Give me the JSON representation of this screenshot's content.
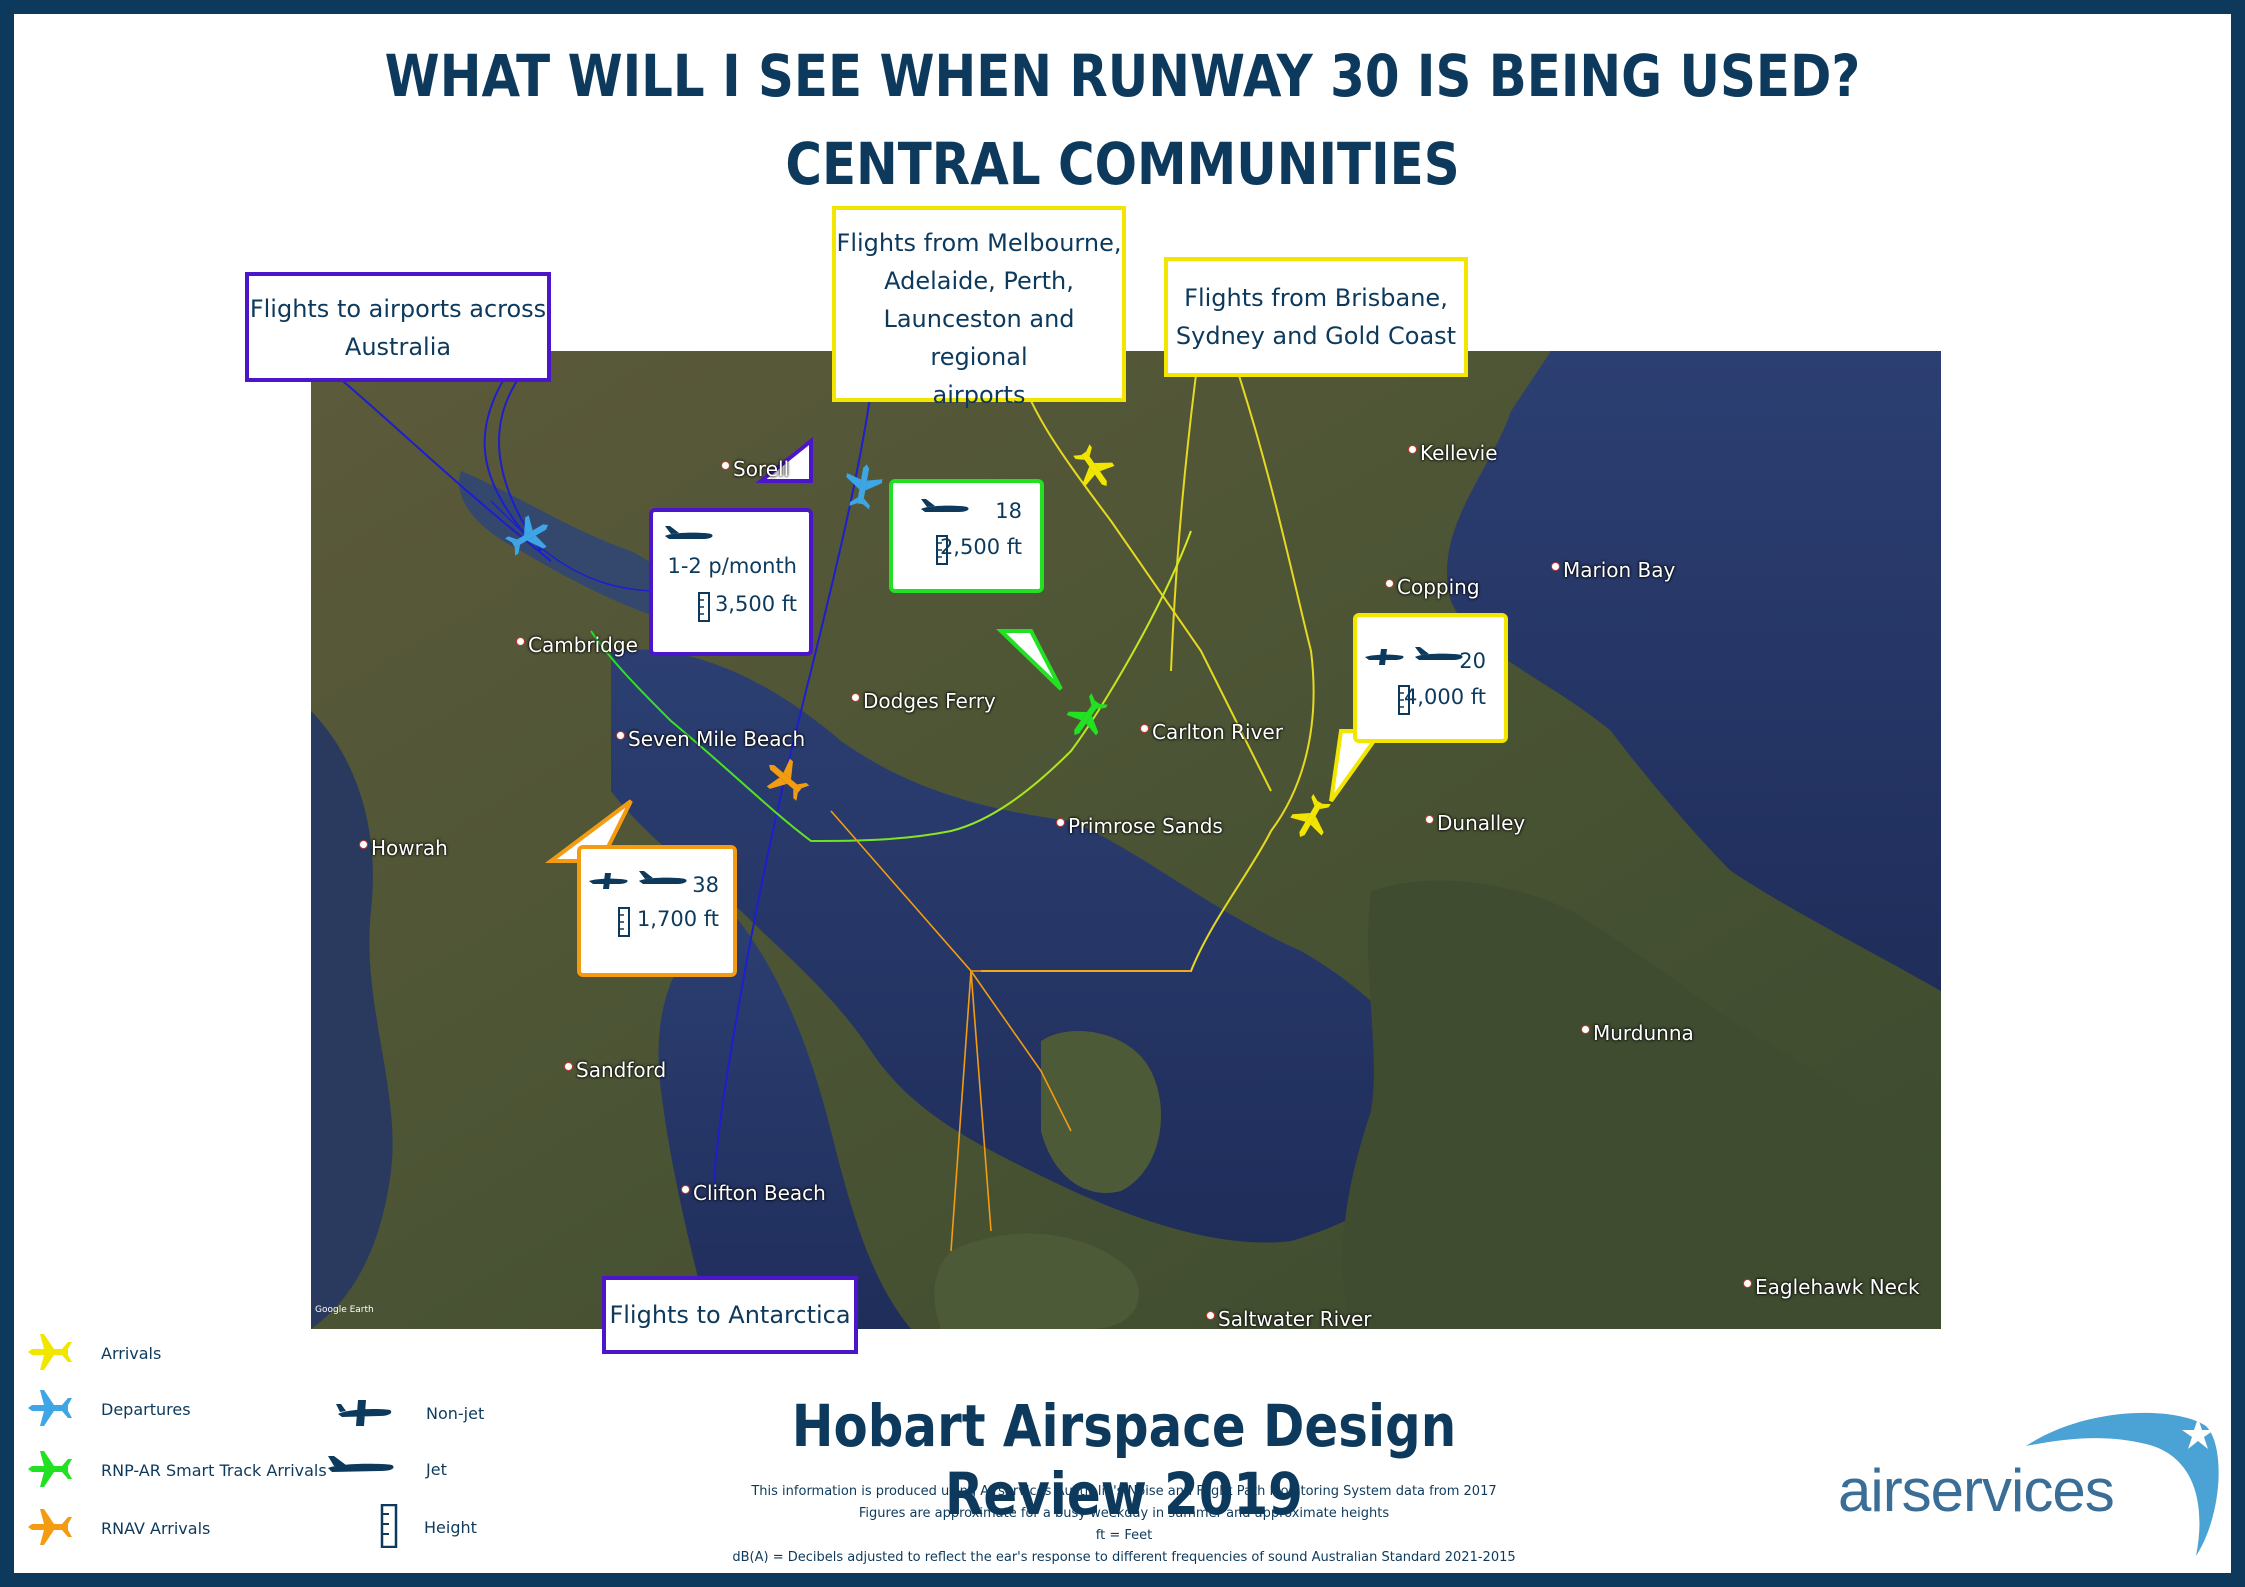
{
  "title_line1": "WHAT WILL I SEE WHEN RUNWAY 30 IS BEING USED?",
  "title_line2": "CENTRAL COMMUNITIES",
  "colors": {
    "frame": "#0d3a5c",
    "arrivals": "#f2e600",
    "departures": "#3ea6e6",
    "rnp_ar": "#22e022",
    "rnav": "#f39c12",
    "departure_box": "#4b16c9"
  },
  "callouts": {
    "departures_australia": [
      "Flights to airports across",
      "Australia"
    ],
    "arrivals_melbourne": [
      "Flights from Melbourne,",
      "Adelaide, Perth,",
      "Launceston and regional",
      "airports"
    ],
    "arrivals_brisbane": [
      "Flights from Brisbane,",
      "Sydney and Gold Coast"
    ],
    "departures_antarctica": [
      "Flights to Antarctica"
    ]
  },
  "stats": {
    "purple": {
      "count": "1-2 p/month",
      "height": "3,500 ft",
      "aircraft_icons": [
        "jet-icon"
      ]
    },
    "green": {
      "count": "18",
      "height": "2,500 ft",
      "aircraft_icons": [
        "jet-icon"
      ]
    },
    "yellow": {
      "count": "20",
      "height": "4,000 ft",
      "aircraft_icons": [
        "non-jet-icon",
        "jet-icon"
      ]
    },
    "orange": {
      "count": "38",
      "height": "1,700 ft",
      "aircraft_icons": [
        "non-jet-icon",
        "jet-icon"
      ]
    }
  },
  "places": {
    "sorell": "Sorell",
    "kellevie": "Kellevie",
    "cambridge": "Cambridge",
    "copping": "Copping",
    "marion_bay": "Marion Bay",
    "dodges_ferry": "Dodges Ferry",
    "carlton_river": "Carlton River",
    "seven_mile_beach": "Seven Mile Beach",
    "primrose_sands": "Primrose Sands",
    "dunalley": "Dunalley",
    "howrah": "Howrah",
    "murdunna": "Murdunna",
    "sandford": "Sandford",
    "clifton_beach": "Clifton Beach",
    "eaglehawk_neck": "Eaglehawk Neck",
    "saltwater_river": "Saltwater River"
  },
  "map_credit": "Google Earth",
  "legend": {
    "arrivals": "Arrivals",
    "departures": "Departures",
    "rnp_ar": "RNP-AR Smart Track  Arrivals",
    "rnav": "RNAV Arrivals",
    "non_jet": "Non-jet",
    "jet": "Jet",
    "height": "Height"
  },
  "review_title": "Hobart Airspace Design Review 2019",
  "notes": [
    "This information is produced using Airservices Australia's Noise and Flight Path Monitoring System data from 2017",
    "Figures  are approximate for a busy weekday in summer and approximate heights",
    "ft = Feet",
    "dB(A) = Decibels adjusted to reflect the ear's response to different frequencies of sound Australian Standard 2021-2015"
  ],
  "logo_text": "airservices"
}
